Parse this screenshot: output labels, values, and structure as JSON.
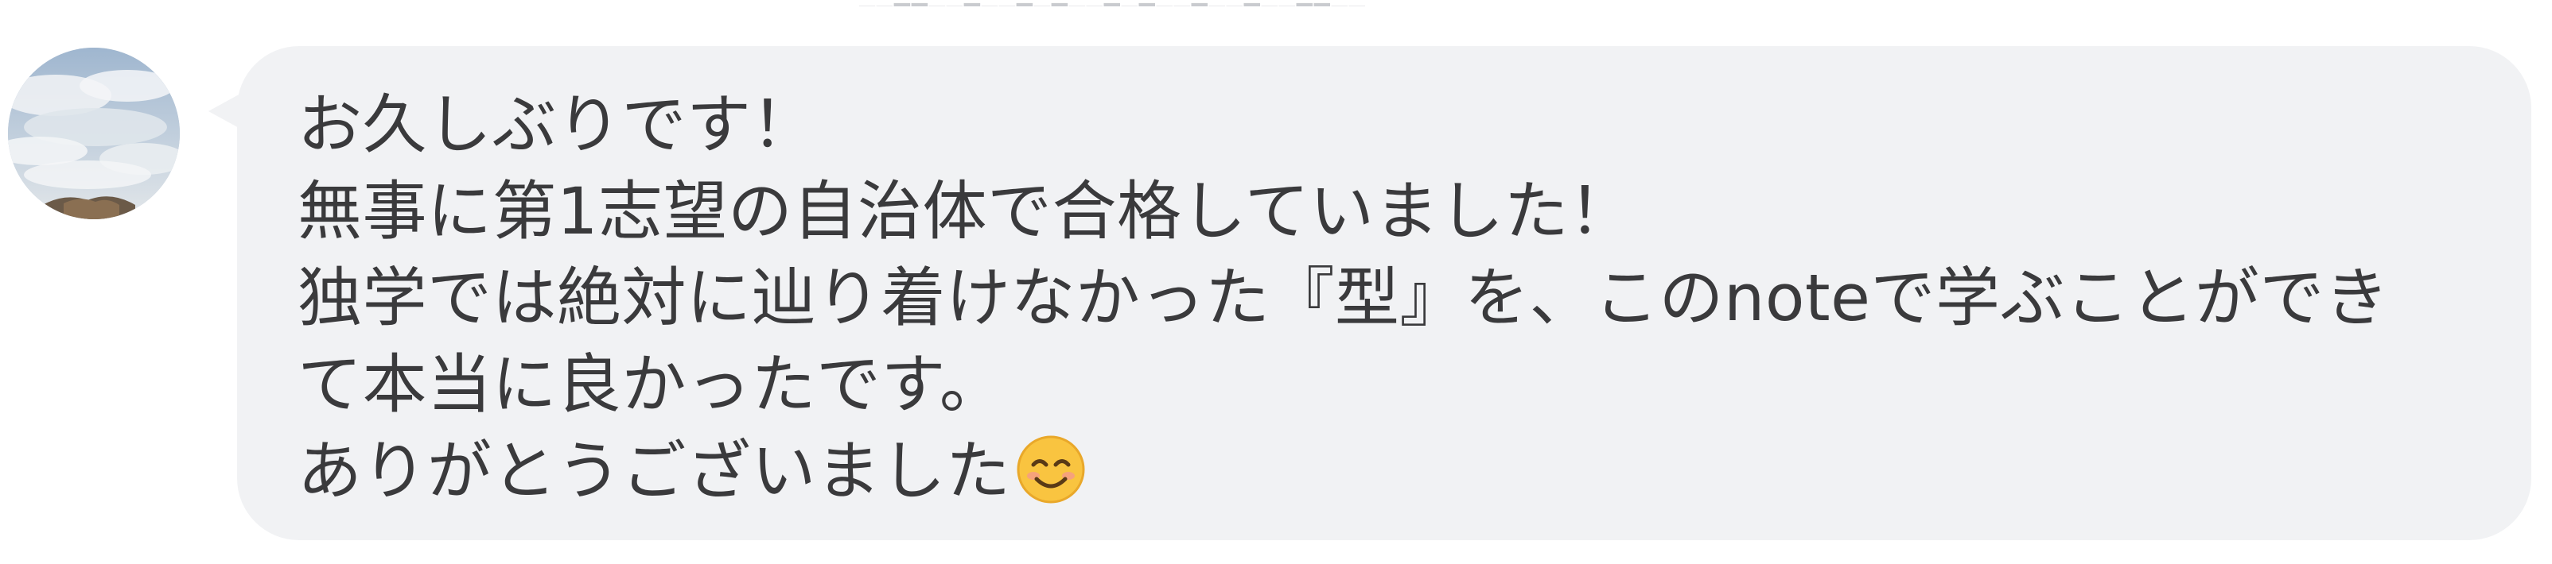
{
  "chat": {
    "avatar_icon": "cloudy-sky-avatar",
    "message": {
      "lines": [
        "お久しぶりです！",
        "無事に第1志望の自治体で合格していました！",
        "独学では絶対に辿り着けなかった『型』を、このnoteで学ぶことができ",
        "て本当に良かったです。",
        "ありがとうございました"
      ],
      "trailing_emoji": "smiling-face-icon"
    },
    "colors": {
      "bubble_background": "#f1f2f4",
      "text": "#3a3a3c",
      "emoji_face": "#f9c440"
    }
  }
}
